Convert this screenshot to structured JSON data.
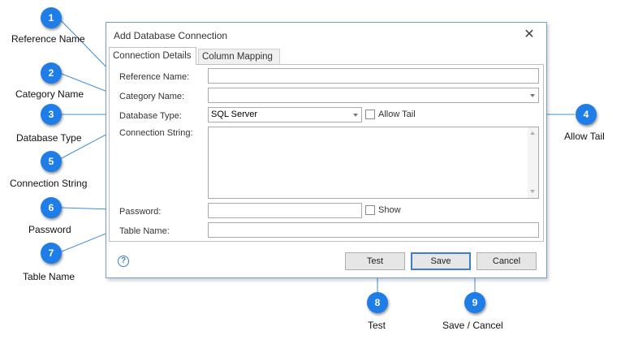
{
  "dialog": {
    "title": "Add Database Connection",
    "close_glyph": "✕",
    "tabs": [
      "Connection Details",
      "Column Mapping"
    ],
    "labels": {
      "reference_name": "Reference Name:",
      "category_name": "Category Name:",
      "database_type": "Database Type:",
      "connection_string": "Connection String:",
      "password": "Password:",
      "table_name": "Table Name:"
    },
    "values": {
      "reference_name": "",
      "category_name": "",
      "database_type": "SQL Server",
      "connection_string": "",
      "password": "",
      "table_name": ""
    },
    "checkboxes": {
      "allow_tail": "Allow Tail",
      "show": "Show"
    },
    "help_glyph": "?",
    "buttons": {
      "test": "Test",
      "save": "Save",
      "cancel": "Cancel"
    }
  },
  "callouts": [
    {
      "number": "1",
      "caption": "Reference Name"
    },
    {
      "number": "2",
      "caption": "Category Name"
    },
    {
      "number": "3",
      "caption": "Database Type"
    },
    {
      "number": "4",
      "caption": "Allow Tail"
    },
    {
      "number": "5",
      "caption": "Connection String"
    },
    {
      "number": "6",
      "caption": "Password"
    },
    {
      "number": "7",
      "caption": "Table Name"
    },
    {
      "number": "8",
      "caption": "Test"
    },
    {
      "number": "9",
      "caption": "Save / Cancel"
    }
  ],
  "colors": {
    "badge": "#1e7de6",
    "callout_line": "#3d8fd6",
    "dialog_border": "#6b9fd2"
  }
}
